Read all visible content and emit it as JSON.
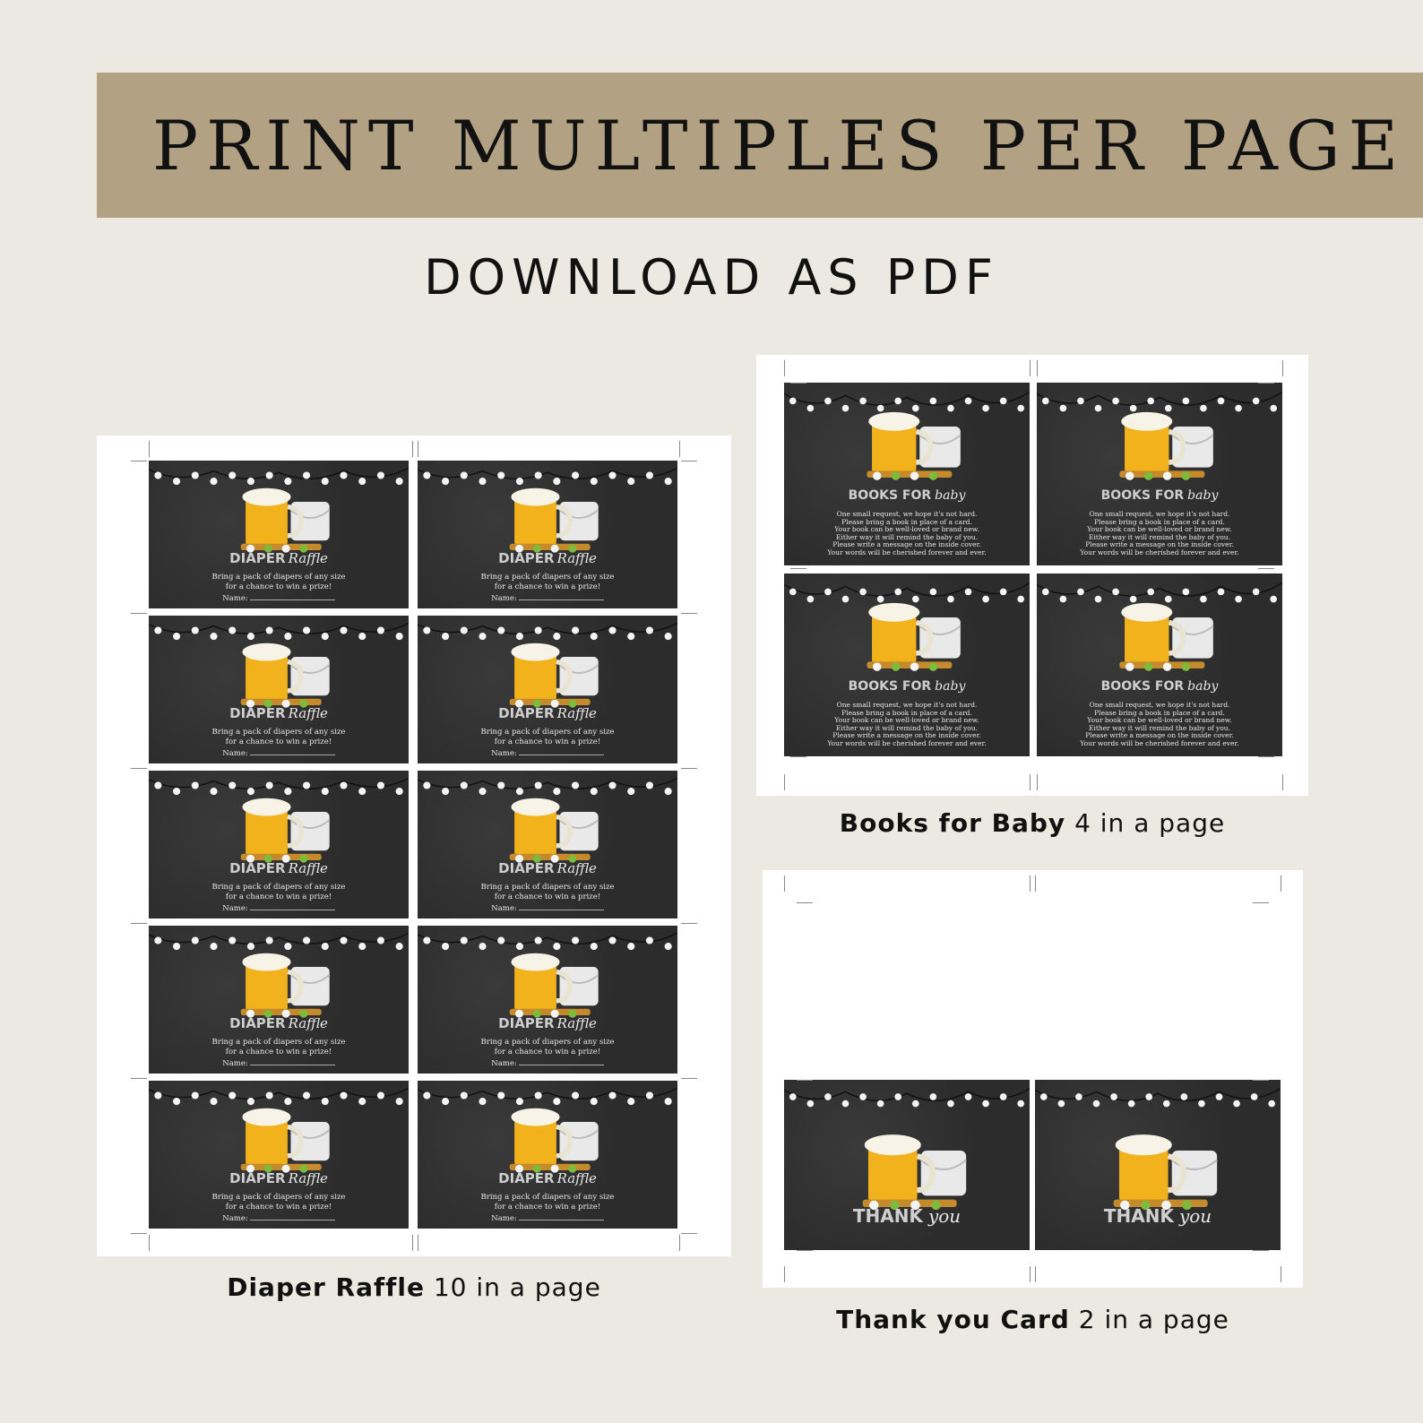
{
  "banner": {
    "title": "PRINT MULTIPLES PER PAGE"
  },
  "subtitle": "DOWNLOAD AS PDF",
  "diaper_raffle": {
    "title_bold": "DIAPER",
    "title_script": "Raffle",
    "line1": "Bring a pack of diapers of any size",
    "line2": "for a chance to win a prize!",
    "name_label": "Name:",
    "caption_bold": "Diaper Raffle",
    "caption_rest": "10 in a page"
  },
  "books_for_baby": {
    "title_bold": "BOOKS FOR",
    "title_script": "baby",
    "lines": [
      "One small request, we hope it's not hard.",
      "Please bring a book in place of a card.",
      "Your book can be well-loved or brand new.",
      "Either way it will remind the baby of you.",
      "Please write a message on the inside cover.",
      "Your words will be cherished forever and ever."
    ],
    "caption_bold": "Books for Baby",
    "caption_rest": "4 in a page"
  },
  "thank_you": {
    "title_bold": "THANK",
    "title_script": "you",
    "caption_bold": "Thank you Card",
    "caption_rest": "2 in a page"
  },
  "colors": {
    "background": "#ece8e2",
    "banner": "#b3a183",
    "card": "#2f2f2f",
    "beer": "#f2b21c"
  }
}
